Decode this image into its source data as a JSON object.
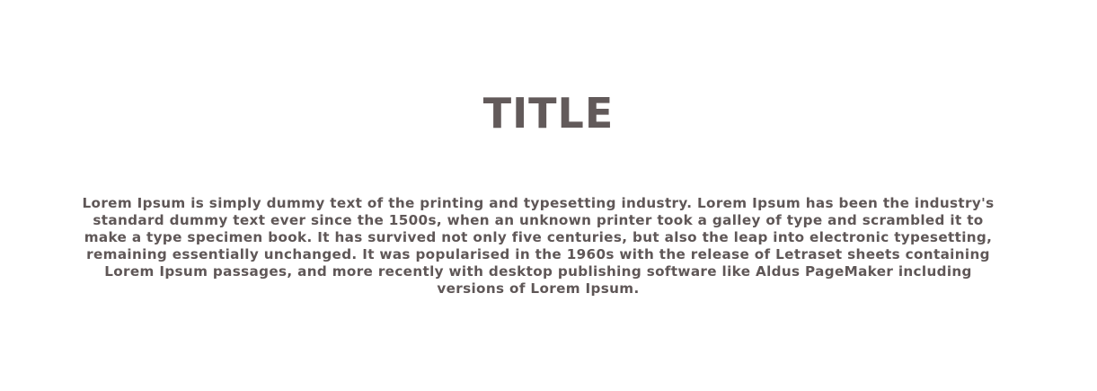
{
  "page": {
    "title": "TITLE",
    "body": "Lorem Ipsum is simply dummy text of the printing and typesetting industry. Lorem Ipsum has been the industry's standard dummy text ever since the 1500s, when an unknown printer took a galley of type and scrambled it to make a type specimen book. It has survived not only five centuries, but also the leap into electronic typesetting, remaining essentially unchanged. It was popularised in the 1960s with the release of Letraset sheets containing Lorem Ipsum passages, and more recently with desktop publishing software like Aldus PageMaker including versions of Lorem Ipsum."
  },
  "colors": {
    "text": "#5f5757",
    "background": "#ffffff"
  }
}
